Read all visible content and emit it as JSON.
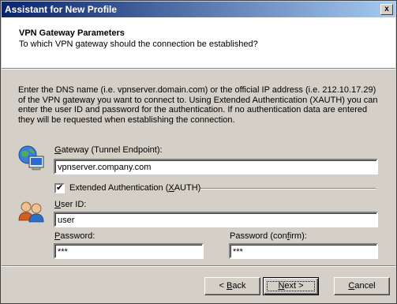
{
  "window": {
    "title": "Assistant for New Profile",
    "close_glyph": "x"
  },
  "header": {
    "title": "VPN Gateway Parameters",
    "subtitle": "To which VPN gateway should the connection be established?"
  },
  "description": "Enter the DNS name (i.e. vpnserver.domain.com) or the official IP address (i.e. 212.10.17.29) of the VPN gateway you want to connect to. Using Extended Authentication (XAUTH) you can enter the user ID and password for the authentication. If no authentication data are entered they will be requested when establishing the connection.",
  "gateway": {
    "label_hotkey": "G",
    "label_rest": "ateway (Tunnel Endpoint):",
    "value": "vpnserver.company.com",
    "icon": "network-computer-icon"
  },
  "xauth": {
    "checked": true,
    "check_glyph": "✔",
    "label_before": "Extended Authentication (",
    "label_hotkey": "X",
    "label_after": "AUTH)",
    "icon": "users-icon"
  },
  "user": {
    "label_hotkey": "U",
    "label_rest": "ser ID:",
    "value": "user"
  },
  "password": {
    "label_hotkey": "P",
    "label_rest": "assword:",
    "value": "***"
  },
  "password_confirm": {
    "label_before": "Password (con",
    "label_hotkey": "f",
    "label_after": "irm):",
    "value": "***"
  },
  "buttons": {
    "back_prefix": "< ",
    "back_hotkey": "B",
    "back_rest": "ack",
    "next_hotkey": "N",
    "next_rest": "ext >",
    "cancel_before": "",
    "cancel_hotkey": "C",
    "cancel_rest": "ancel"
  },
  "colors": {
    "title_bar_start": "#0a246a",
    "title_bar_end": "#a6caf0",
    "dialog_bg": "#d4d0c8"
  }
}
